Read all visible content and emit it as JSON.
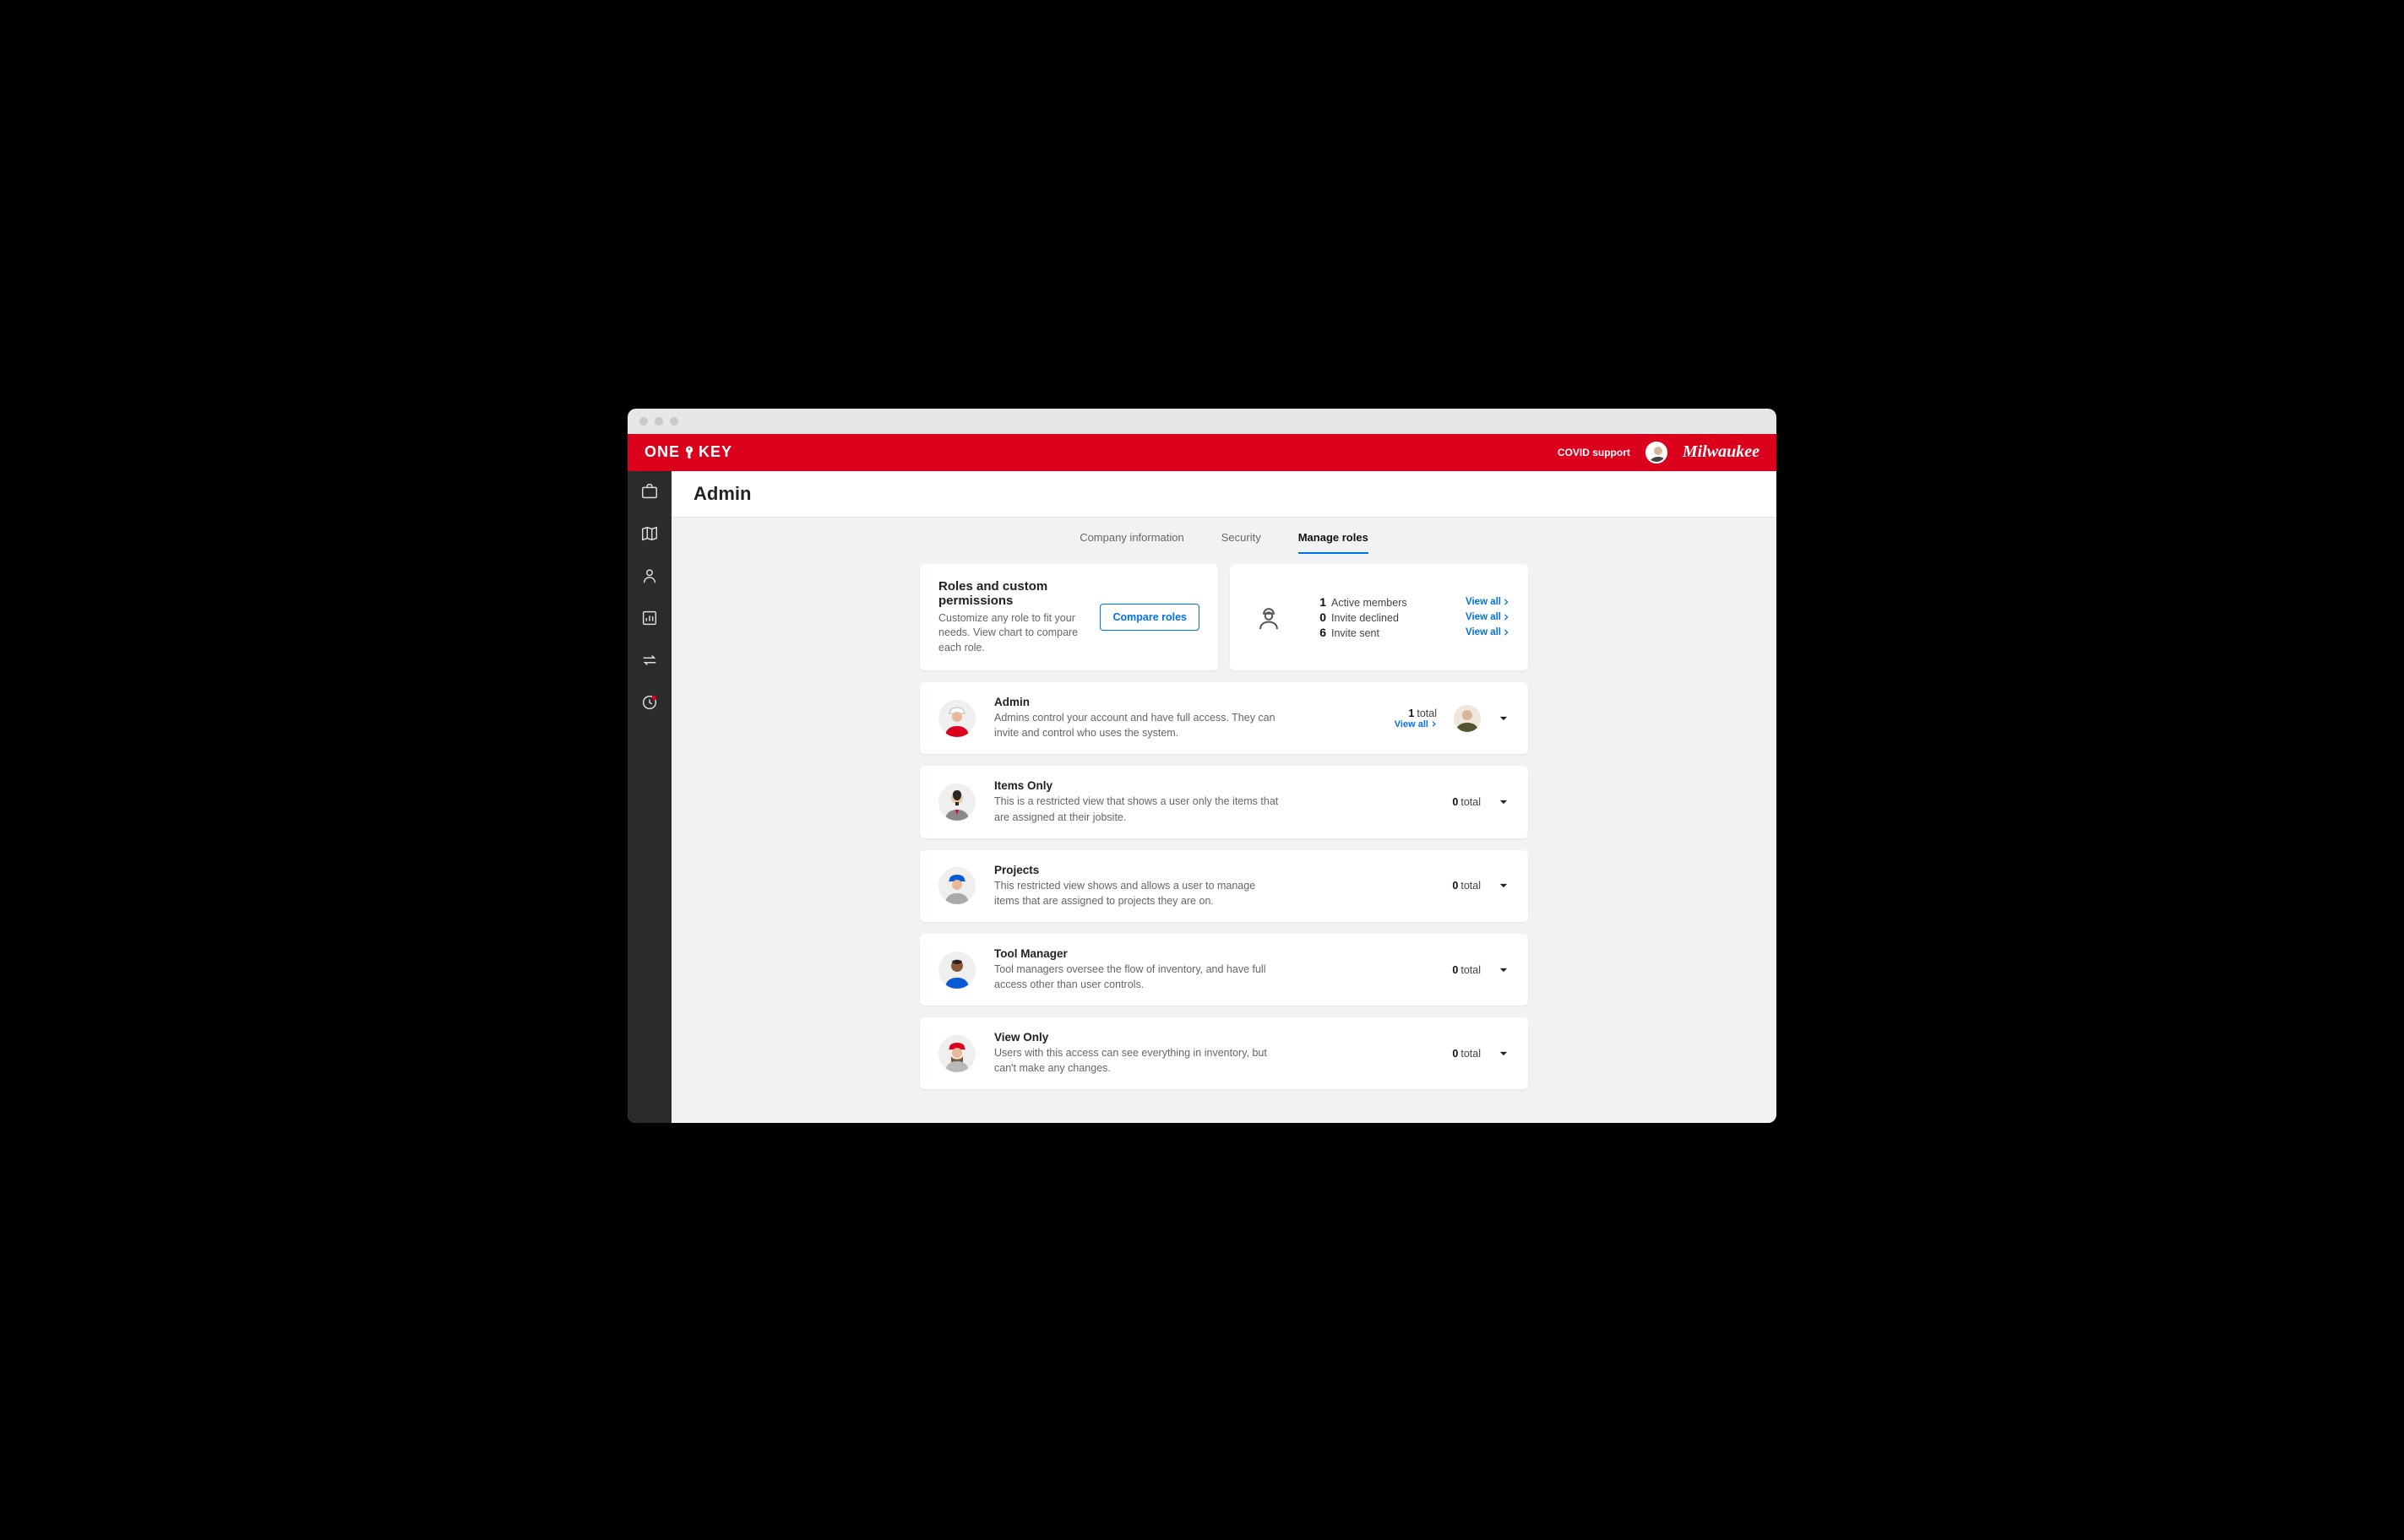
{
  "brand": {
    "left": "ONE",
    "right": "KEY"
  },
  "topbar": {
    "covid_support": "COVID support",
    "partner_brand": "Milwaukee"
  },
  "page": {
    "title": "Admin"
  },
  "tabs": [
    {
      "label": "Company information",
      "active": false
    },
    {
      "label": "Security",
      "active": false
    },
    {
      "label": "Manage roles",
      "active": true
    }
  ],
  "roles_panel": {
    "heading": "Roles and custom permissions",
    "subtext": "Customize any role to fit your needs. View chart to compare each role.",
    "compare_btn": "Compare roles"
  },
  "stats": {
    "view_all_label": "View all",
    "lines": [
      {
        "count": "1",
        "label": "Active members"
      },
      {
        "count": "0",
        "label": "Invite declined"
      },
      {
        "count": "6",
        "label": "Invite sent"
      }
    ]
  },
  "roles": [
    {
      "name": "Admin",
      "desc": "Admins control your account and have full access. They can invite and control who uses the system.",
      "total": "1",
      "total_label": "total",
      "view_all": "View all",
      "has_member_avatar": true
    },
    {
      "name": "Items Only",
      "desc": "This is a restricted view that shows a user only the items that are assigned at their jobsite.",
      "total": "0",
      "total_label": "total",
      "has_member_avatar": false
    },
    {
      "name": "Projects",
      "desc": "This restricted view shows and allows a user to manage items that are assigned to projects they are on.",
      "total": "0",
      "total_label": "total",
      "has_member_avatar": false
    },
    {
      "name": "Tool Manager",
      "desc": "Tool managers oversee the flow of inventory, and have full access other than user controls.",
      "total": "0",
      "total_label": "total",
      "has_member_avatar": false
    },
    {
      "name": "View Only",
      "desc": "Users with this access can see everything in inventory, but can't make any changes.",
      "total": "0",
      "total_label": "total",
      "has_member_avatar": false
    }
  ],
  "colors": {
    "brand_red": "#db011c",
    "link_blue": "#0072ed"
  }
}
